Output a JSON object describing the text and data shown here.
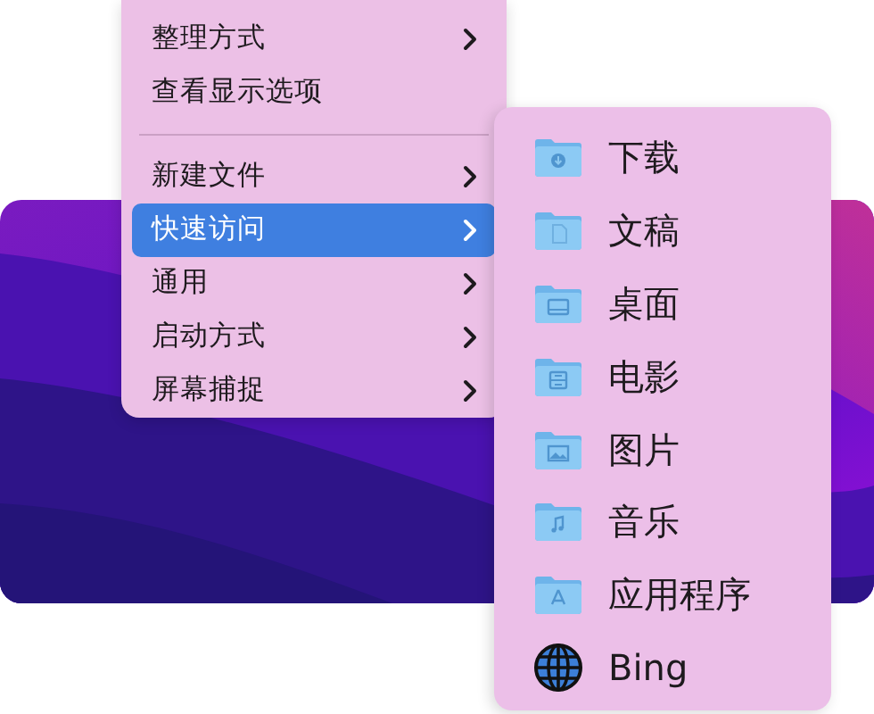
{
  "context_menu": {
    "items": [
      {
        "kind": "item",
        "label": "整理方式",
        "has_submenu": true,
        "selected": false
      },
      {
        "kind": "item",
        "label": "查看显示选项",
        "has_submenu": false,
        "selected": false
      },
      {
        "kind": "separator"
      },
      {
        "kind": "item",
        "label": "新建文件",
        "has_submenu": true,
        "selected": false
      },
      {
        "kind": "item",
        "label": "快速访问",
        "has_submenu": true,
        "selected": true
      },
      {
        "kind": "item",
        "label": "通用",
        "has_submenu": true,
        "selected": false
      },
      {
        "kind": "item",
        "label": "启动方式",
        "has_submenu": true,
        "selected": false
      },
      {
        "kind": "item",
        "label": "屏幕捕捉",
        "has_submenu": true,
        "selected": false
      }
    ]
  },
  "submenu": {
    "items": [
      {
        "kind": "folder",
        "label": "下载"
      },
      {
        "kind": "folder",
        "label": "文稿"
      },
      {
        "kind": "folder",
        "label": "桌面"
      },
      {
        "kind": "folder",
        "label": "电影"
      },
      {
        "kind": "folder",
        "label": "图片"
      },
      {
        "kind": "folder",
        "label": "音乐"
      },
      {
        "kind": "folder",
        "label": "应用程序"
      },
      {
        "kind": "web",
        "label": "Bing"
      }
    ]
  }
}
